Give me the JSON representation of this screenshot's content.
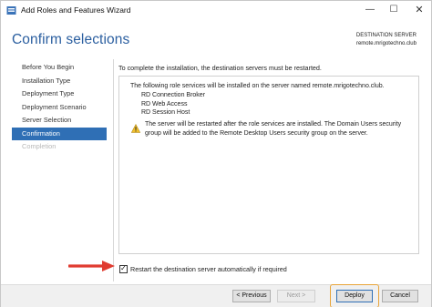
{
  "window": {
    "title": "Add Roles and Features Wizard",
    "controls": {
      "minimize": "—",
      "maximize": "☐",
      "close": "✕"
    }
  },
  "header": {
    "page_title": "Confirm selections",
    "destination_label": "DESTINATION SERVER",
    "destination_server": "remote.mrigotechno.club"
  },
  "nav": {
    "items": [
      {
        "label": "Before You Begin",
        "state": "normal"
      },
      {
        "label": "Installation Type",
        "state": "normal"
      },
      {
        "label": "Deployment Type",
        "state": "normal"
      },
      {
        "label": "Deployment Scenario",
        "state": "normal"
      },
      {
        "label": "Server Selection",
        "state": "normal"
      },
      {
        "label": "Confirmation",
        "state": "active"
      },
      {
        "label": "Completion",
        "state": "disabled"
      }
    ]
  },
  "main": {
    "intro": "To complete the installation, the destination servers must be restarted.",
    "panel_heading": "The following role services will be installed on the server named remote.mrigotechno.club.",
    "services": [
      "RD Connection Broker",
      "RD Web Access",
      "RD Session Host"
    ],
    "warning_text": "The server will be restarted after the role services are installed. The Domain Users security group will be added to the Remote Desktop Users security group on the server.",
    "warning_icon": "warning-triangle-icon",
    "restart_label": "Restart the destination server automatically if required",
    "restart_checked": true,
    "checkmark": "✓"
  },
  "footer": {
    "previous_label": "< Previous",
    "next_label": "Next >",
    "deploy_label": "Deploy",
    "cancel_label": "Cancel"
  },
  "colors": {
    "accent": "#2f6fb5",
    "title": "#2b5fa0",
    "annotation_arrow": "#e03c31",
    "annotation_highlight": "#e8a53a"
  }
}
